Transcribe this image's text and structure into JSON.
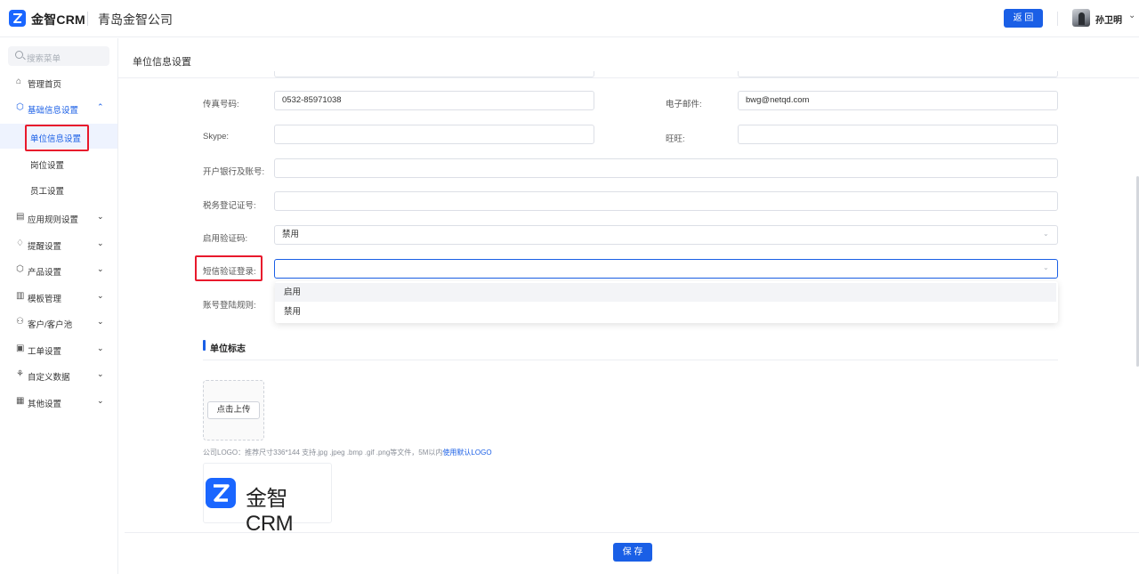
{
  "topbar": {
    "app_name": "金智CRM",
    "company": "青岛金智公司",
    "back_label": "返 回",
    "user_name": "孙卫明",
    "user_caret": "⌄"
  },
  "sidebar": {
    "search_placeholder": "搜索菜单",
    "items": [
      {
        "label": "管理首页",
        "icon": "⌂"
      },
      {
        "label": "基础信息设置",
        "icon": "⬡",
        "caret": "⌃"
      },
      {
        "label": "应用规则设置",
        "icon": "▤",
        "caret": "⌄"
      },
      {
        "label": "提醒设置",
        "icon": "♢",
        "caret": "⌄"
      },
      {
        "label": "产品设置",
        "icon": "⬡",
        "caret": "⌄"
      },
      {
        "label": "模板管理",
        "icon": "▥",
        "caret": "⌄"
      },
      {
        "label": "客户/客户池",
        "icon": "⚇",
        "caret": "⌄"
      },
      {
        "label": "工单设置",
        "icon": "▣",
        "caret": "⌄"
      },
      {
        "label": "自定义数据",
        "icon": "⚘",
        "caret": "⌄"
      },
      {
        "label": "其他设置",
        "icon": "▦",
        "caret": "⌄"
      }
    ],
    "sub_items": [
      {
        "label": "单位信息设置"
      },
      {
        "label": "岗位设置"
      },
      {
        "label": "员工设置"
      }
    ]
  },
  "main": {
    "page_title": "单位信息设置",
    "fields": {
      "fax_label": "传真号码:",
      "fax_value": "0532-85971038",
      "email_label": "电子邮件:",
      "email_value": "bwg@netqd.com",
      "skype_label": "Skype:",
      "skype_value": "",
      "wangwang_label": "旺旺:",
      "wangwang_value": "",
      "bank_label": "开户银行及账号:",
      "bank_value": "",
      "tax_label": "税务登记证号:",
      "tax_value": "",
      "captcha_label": "启用验证码:",
      "captcha_value": "禁用",
      "sms_label": "短信验证登录:",
      "sms_value": "",
      "account_rule_label": "账号登陆规则:"
    },
    "dropdown_options": [
      "启用",
      "禁用"
    ],
    "select_caret": "⌄",
    "logo_section": {
      "title": "单位标志",
      "upload_label": "点击上传",
      "hint": "公司LOGO：推荐尺寸336*144 支持.jpg .jpeg .bmp .gif .png等文件，5M以内",
      "hint_link": "使用默认LOGO",
      "preview_name": "金智CRM"
    },
    "save_label": "保 存"
  },
  "colors": {
    "primary": "#1a5fe6",
    "brand": "#1a66ff",
    "highlight": "#e8192c"
  }
}
